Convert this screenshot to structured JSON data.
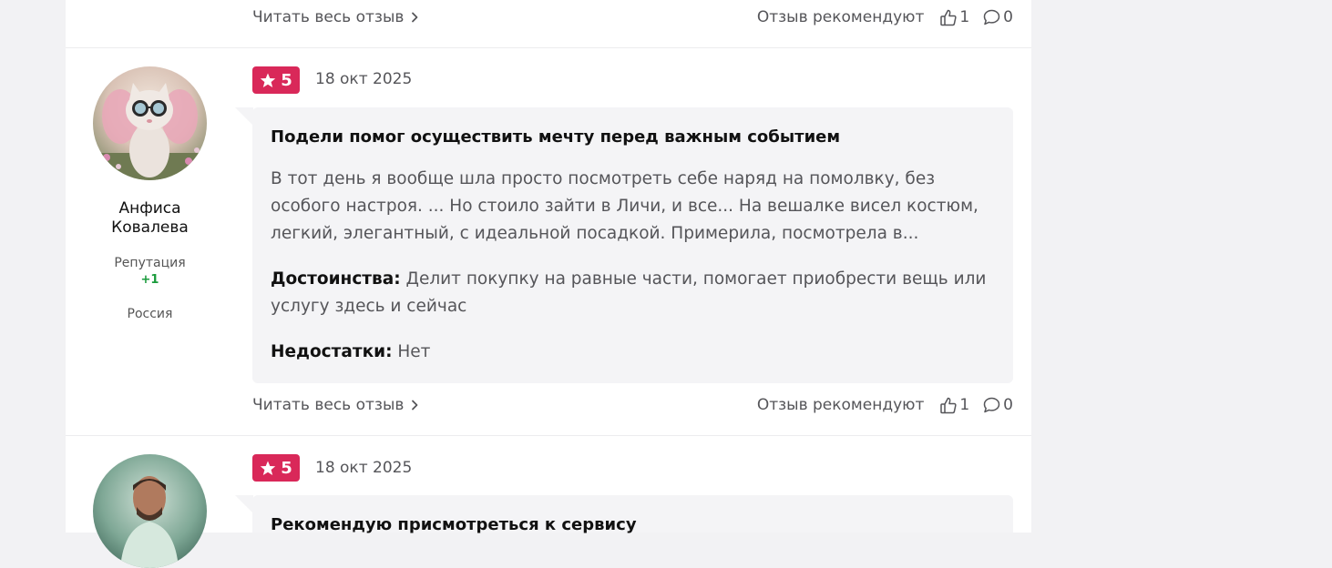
{
  "footer_common": {
    "read_all_label": "Читать весь отзыв",
    "recommend_label": "Отзыв рекомендуют"
  },
  "reviews": [
    {
      "read_all_label": "Читать весь отзыв",
      "recommend_label": "Отзыв рекомендуют",
      "likes": "1",
      "comments": "0"
    },
    {
      "user": {
        "name": "Анфиса Ковалева",
        "reputation_label": "Репутация",
        "reputation_value": "+1",
        "country": "Россия"
      },
      "rating": "5",
      "date": "18 окт 2025",
      "title": "Подели помог осуществить мечту перед важным событием",
      "excerpt": "В тот день я вообще шла просто посмотреть себе наряд на помолвку, без особого настроя. ... Но стоило зайти в Личи, и все... На вешалке висел костюм, легкий, элегантный, с идеальной посадкой. Примерила, посмотрела в...",
      "pros_label": "Достоинства:",
      "pros": "Делит покупку на равные части, помогает приобрести вещь или услугу здесь и сейчас",
      "cons_label": "Недостатки:",
      "cons": "Нет",
      "read_all_label": "Читать весь отзыв",
      "recommend_label": "Отзыв рекомендуют",
      "likes": "1",
      "comments": "0"
    },
    {
      "rating": "5",
      "date": "18 окт 2025",
      "title": "Рекомендую присмотреться к сервису"
    }
  ],
  "colors": {
    "rating_badge": "#d92859",
    "reputation_positive": "#1a9b3c",
    "page_background": "#f2f2f4",
    "bubble_background": "#f4f4f6"
  },
  "icons": {
    "star": "star-icon",
    "thumb_up": "thumb-up-icon",
    "comment": "comment-bubble-icon",
    "chevron": "chevron-right-icon"
  }
}
